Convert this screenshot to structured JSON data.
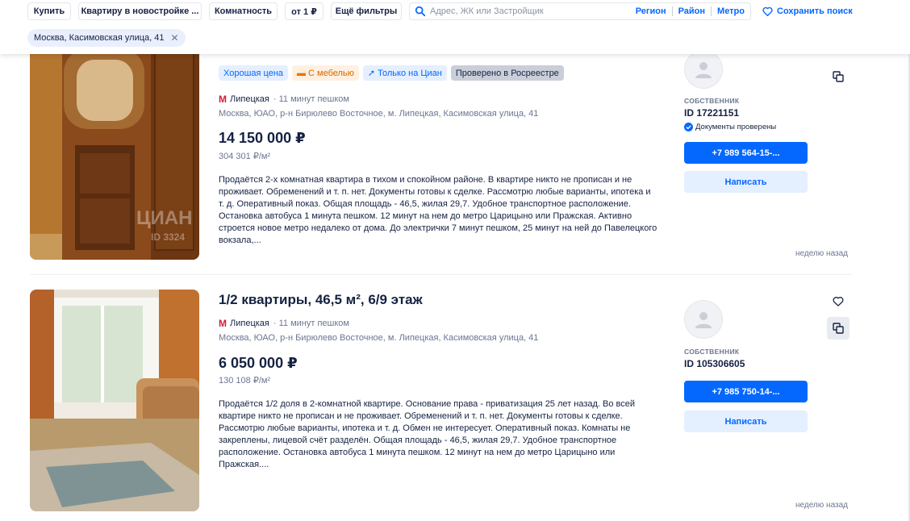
{
  "filters": {
    "buy": "Купить",
    "type": "Квартиру в новостройке ...",
    "rooms": "Комнатность",
    "price": "от 1 ₽",
    "more": "Ещё фильтры",
    "search_placeholder": "Адрес, ЖК или Застройщик",
    "region": "Регион",
    "district": "Район",
    "metro": "Метро",
    "save_search": "Сохранить поиск",
    "chip": "Москва, Касимовская улица, 41",
    "chip_close": "✕"
  },
  "listings": [
    {
      "badges": [
        "Хорошая цена",
        "С мебелью",
        "Только на Циан",
        "Проверено в Росреестре"
      ],
      "metro_station": "Липецкая",
      "metro_distance": "· 11 минут пешком",
      "address": "Москва, ЮАО, р-н Бирюлево Восточное, м. Липецкая, Касимовская улица, 41",
      "price": "14 150 000 ₽",
      "price_per_meter": "304 301 ₽/м²",
      "description": "Продаётся 2-х комнатная квартира в тихом и спокойном районе. В квартире никто не прописан и не проживает. Обременений и т. п. нет. Документы готовы к сделке. Рассмотрю любые варианты, ипотека и т. д. Оперативный показ. Общая площадь - 46,5, жилая 29,7. Удобное транспортное расположение. Остановка автобуса 1 минута пешком. 12 минут на нем до метро Царицыно или Пражская. Активно строется новое метро недалеко от дома. До электрички 7 минут пешком, 25 минут на ней до Павелецкого вокзала,...",
      "owner_role": "СОБСТВЕННИК",
      "owner_id": "ID 17221151",
      "docs_checked": "Документы проверены",
      "phone": "+7 989 564-15-...",
      "write": "Написать",
      "posted": "неделю назад",
      "watermark": "ЦИАН",
      "watermark_id": "ID 3324"
    },
    {
      "title": "1/2 квартиры, 46,5 м², 6/9 этаж",
      "metro_station": "Липецкая",
      "metro_distance": "· 11 минут пешком",
      "address": "Москва, ЮАО, р-н Бирюлево Восточное, м. Липецкая, Касимовская улица, 41",
      "price": "6 050 000 ₽",
      "price_per_meter": "130 108 ₽/м²",
      "description": "Продаётся 1/2 доля в 2-комнатной квартире. Основание права - приватизация 25 лет назад. Во всей квартире никто не прописан и не проживает. Обременений и т. п. нет. Документы готовы к сделке. Рассмотрю любые варианты, ипотека и т. д. Обмен не интересует. Оперативный показ. Комнаты не закреплены, лицевой счёт разделён. Общая площадь - 46,5, жилая 29,7. Удобное транспортное расположение. Остановка автобуса 1 минута пешком. 12 минут на нем до метро Царицыно или Пражская....",
      "owner_role": "СОБСТВЕННИК",
      "owner_id": "ID 105306605",
      "phone": "+7 985 750-14-...",
      "write": "Написать",
      "posted": "неделю назад"
    }
  ]
}
